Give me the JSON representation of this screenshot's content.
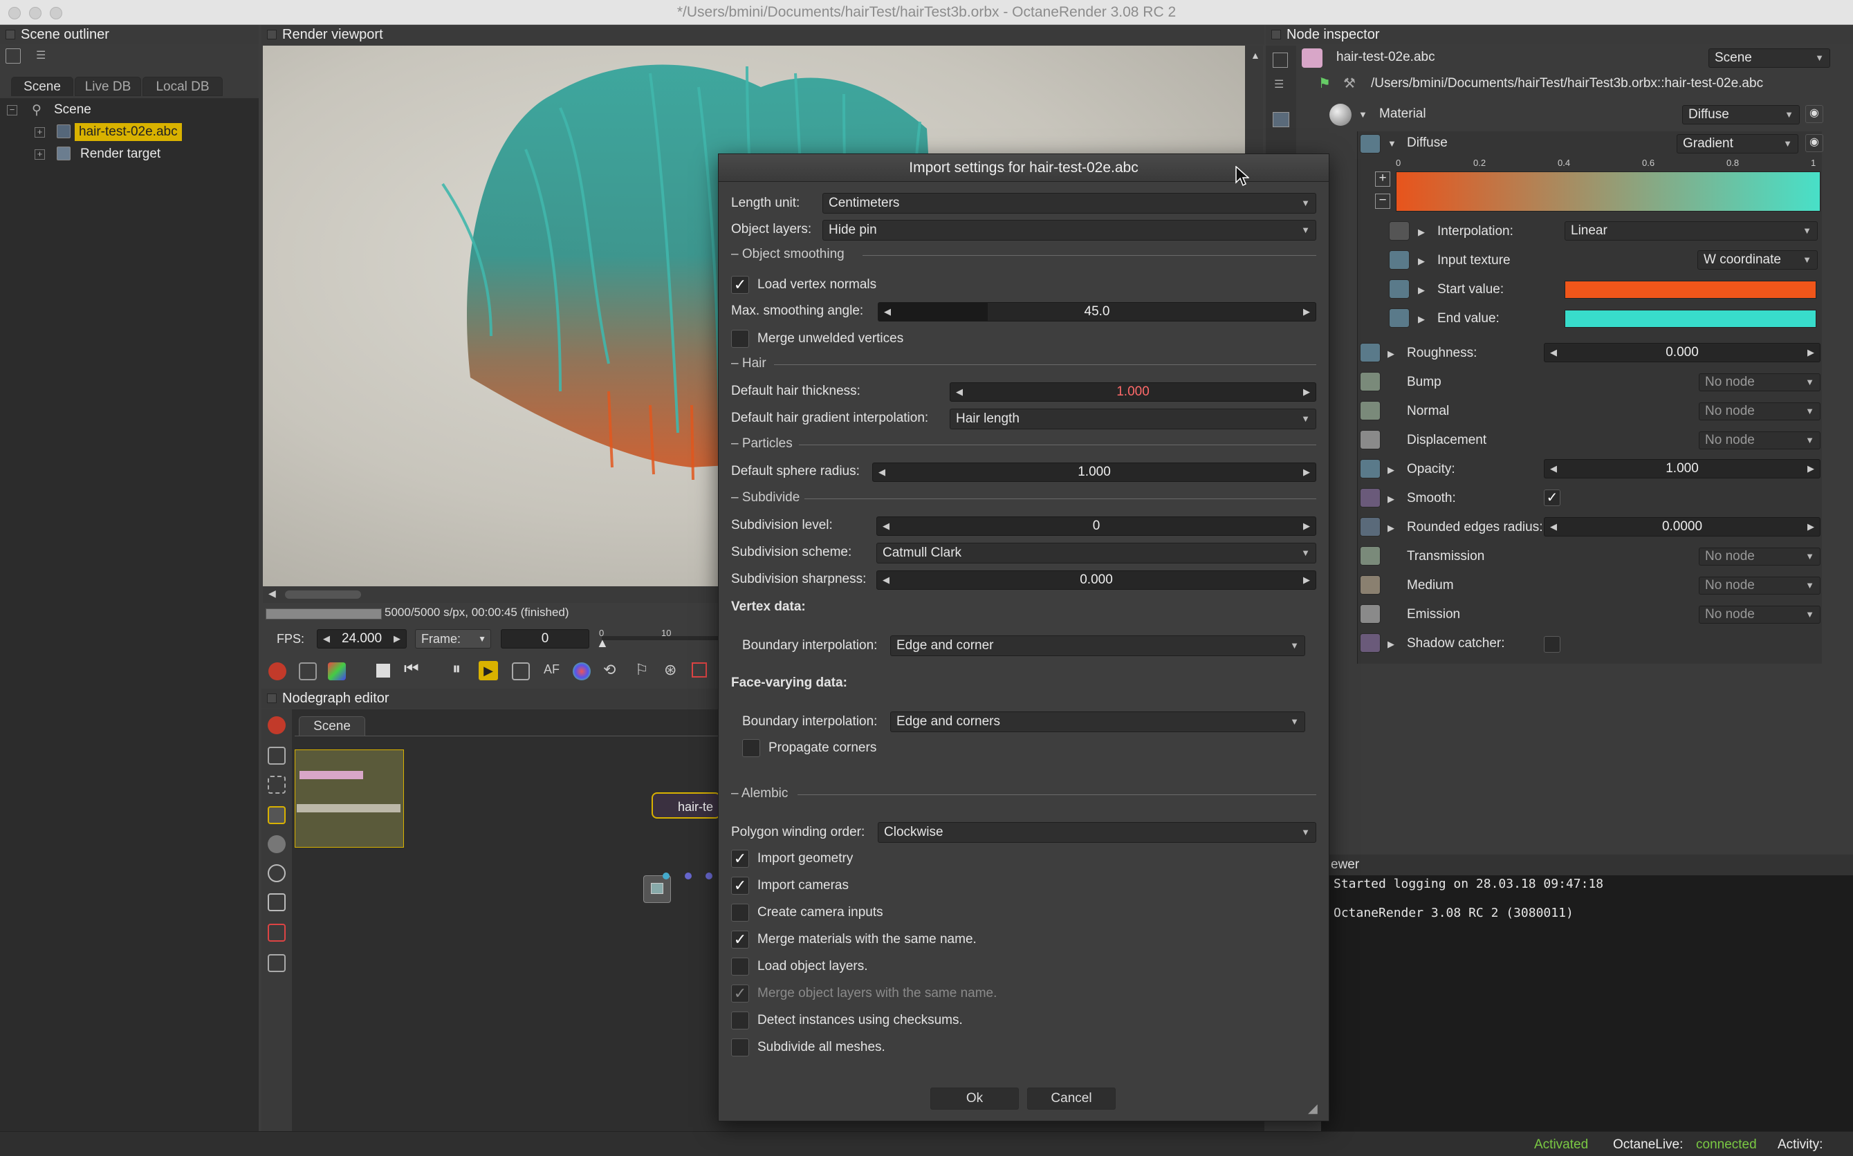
{
  "window": {
    "title": "*/Users/bmini/Documents/hairTest/hairTest3b.orbx - OctaneRender 3.08 RC 2"
  },
  "outliner": {
    "title": "Scene outliner",
    "tabs": [
      "Scene",
      "Live DB",
      "Local DB"
    ],
    "tree": {
      "root": "Scene",
      "items": [
        "hair-test-02e.abc",
        "Render target"
      ]
    }
  },
  "viewport": {
    "title": "Render viewport",
    "progress_text": "5000/5000 s/px, 00:00:45 (finished)",
    "progress": 1.0,
    "fps_label": "FPS:",
    "fps_value": "24.000",
    "frame_label": "Frame:",
    "frame_value": "0",
    "timeline_ticks": [
      "0",
      "10"
    ]
  },
  "nodegraph": {
    "title": "Nodegraph editor",
    "tab": "Scene",
    "node_label": "hair-te"
  },
  "inspector": {
    "title": "Node inspector",
    "node_name": "hair-test-02e.abc",
    "scene_dd": "Scene",
    "path": "/Users/bmini/Documents/hairTest/hairTest3b.orbx::hair-test-02e.abc",
    "material_label": "Material",
    "material_type": "Diffuse",
    "diffuse_label": "Diffuse",
    "diffuse_type": "Gradient",
    "gradient_ticks": [
      "0",
      "0.2",
      "0.4",
      "0.6",
      "0.8",
      "1"
    ],
    "gradient_colors": [
      "#e8541c",
      "#48e0c8"
    ],
    "interpolation_label": "Interpolation:",
    "interpolation_value": "Linear",
    "input_texture_label": "Input texture",
    "input_texture_value": "W coordinate",
    "start_value_label": "Start value:",
    "start_color": "#f0561a",
    "end_value_label": "End value:",
    "end_color": "#38dccb",
    "roughness_label": "Roughness:",
    "roughness_value": "0.000",
    "bump_label": "Bump",
    "normal_label": "Normal",
    "displacement_label": "Displacement",
    "opacity_label": "Opacity:",
    "opacity_value": "1.000",
    "smooth_label": "Smooth:",
    "smooth_check": "✓",
    "rounded_label": "Rounded edges radius:",
    "rounded_value": "0.0000",
    "transmission_label": "Transmission",
    "medium_label": "Medium",
    "emission_label": "Emission",
    "shadow_label": "Shadow catcher:",
    "no_node": "No node"
  },
  "log": {
    "title": "ewer",
    "lines": [
      "Started logging on 28.03.18 09:47:18",
      "OctaneRender 3.08 RC 2 (3080011)"
    ]
  },
  "dialog": {
    "title": "Import settings for hair-test-02e.abc",
    "length_unit_label": "Length unit:",
    "length_unit_value": "Centimeters",
    "object_layers_label": "Object layers:",
    "object_layers_value": "Hide pin",
    "sec_smoothing": "Object smoothing",
    "load_vertex_normals": "Load vertex normals",
    "max_smoothing_label": "Max. smoothing angle:",
    "max_smoothing_value": "45.0",
    "max_smoothing_fraction": 0.25,
    "merge_unwelded": "Merge unwelded vertices",
    "sec_hair": "Hair",
    "hair_thickness_label": "Default hair thickness:",
    "hair_thickness_value": "1.000",
    "hair_gradient_label": "Default hair gradient interpolation:",
    "hair_gradient_value": "Hair length",
    "sec_particles": "Particles",
    "sphere_radius_label": "Default sphere radius:",
    "sphere_radius_value": "1.000",
    "sec_subdivide": "Subdivide",
    "subdiv_level_label": "Subdivision level:",
    "subdiv_level_value": "0",
    "subdiv_scheme_label": "Subdivision scheme:",
    "subdiv_scheme_value": "Catmull Clark",
    "subdiv_sharp_label": "Subdivision sharpness:",
    "subdiv_sharp_value": "0.000",
    "vertex_data": "Vertex data:",
    "boundary_label": "Boundary interpolation:",
    "vertex_boundary_value": "Edge and corner",
    "face_varying": "Face-varying data:",
    "face_boundary_value": "Edge and corners",
    "propagate": "Propagate corners",
    "sec_alembic": "Alembic",
    "winding_label": "Polygon winding order:",
    "winding_value": "Clockwise",
    "opt_geometry": "Import geometry",
    "opt_cameras": "Import cameras",
    "opt_cam_inputs": "Create camera inputs",
    "opt_merge_mats": "Merge materials with the same name.",
    "opt_load_layers": "Load object layers.",
    "opt_merge_layers": "Merge object layers with the same name.",
    "opt_instances": "Detect instances using checksums.",
    "opt_subdiv_all": "Subdivide all meshes.",
    "ok": "Ok",
    "cancel": "Cancel",
    "check": "✓"
  },
  "statusbar": {
    "activated": "Activated",
    "octanelive_label": "OctaneLive:",
    "octanelive_value": "connected",
    "activity_label": "Activity:"
  }
}
